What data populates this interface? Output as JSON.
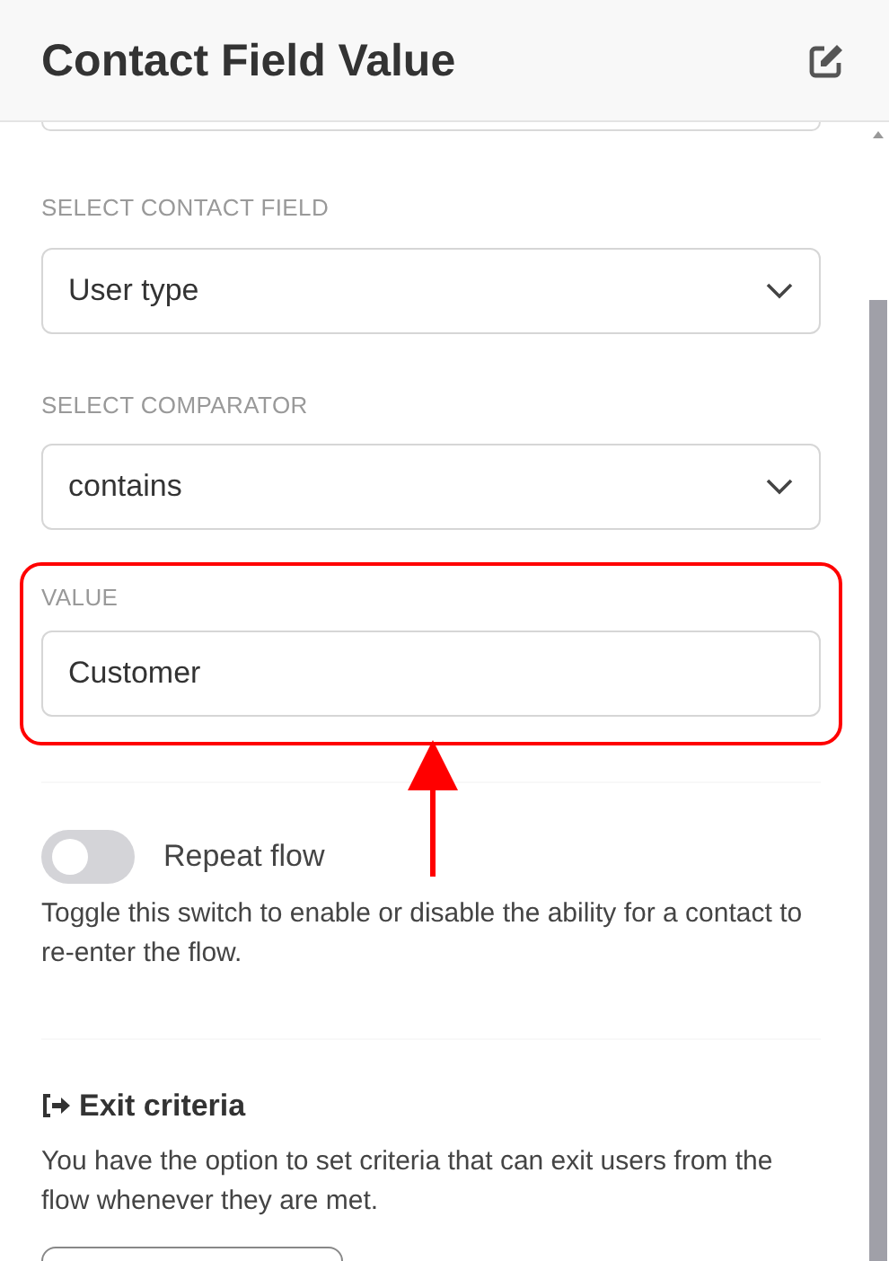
{
  "header": {
    "title": "Contact Field Value"
  },
  "fields": [
    {
      "label": "SELECT CONTACT FIELD",
      "value": "User type",
      "kind": "select",
      "highlighted": false
    },
    {
      "label": "SELECT COMPARATOR",
      "value": "contains",
      "kind": "select",
      "highlighted": false
    },
    {
      "label": "VALUE",
      "value": "Customer",
      "kind": "text",
      "highlighted": true
    }
  ],
  "repeat_flow": {
    "label": "Repeat flow",
    "on": false,
    "description": "Toggle this switch to enable or disable the ability for a contact to re-enter the flow."
  },
  "exit_criteria": {
    "title": "Exit criteria",
    "description": "You have the option to set criteria that can exit users from the flow whenever they are met."
  }
}
